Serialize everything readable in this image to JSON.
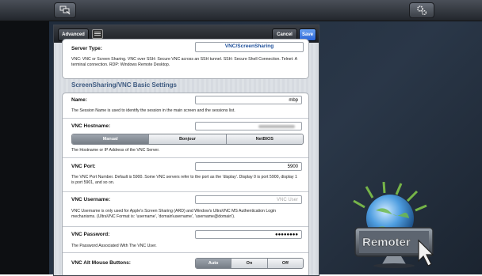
{
  "topbar": {
    "left_icon": "remote-screens-icon",
    "right_icon": "gear-icon"
  },
  "panel": {
    "header": {
      "advanced_label": "Advanced",
      "keyboard_icon": "keyboard-icon",
      "cancel_label": "Cancel",
      "save_label": "Save"
    },
    "server_type": {
      "label": "Server Type:",
      "value": "VNC/ScreenSharing",
      "description": "VNC: VNC or Screen Sharing. VNC over SSH: Secure VNC across an SSH tunnel. SSH: Secure Shell Connection. Telnet: A terminal connection. RDP: Windows Remote Desktop."
    },
    "section_title": "ScreenSharing/VNC Basic Settings",
    "name": {
      "label": "Name:",
      "value": "mbp",
      "description": "The Session Name is used to identify the session in the main screen and the sessions list."
    },
    "hostname": {
      "label": "VNC Hostname:",
      "value": "",
      "segments": [
        "Manual",
        "Bonjour",
        "NetBIOS"
      ],
      "selected": "Manual",
      "description": "The Hostname or IP Address of the VNC Server."
    },
    "port": {
      "label": "VNC Port:",
      "value": "5900",
      "description": "The VNC Port Number. Default is 5900. Some VNC servers refer to the port as the 'display'. Display 0 is port 5900, display 1 is port 5901, and so on."
    },
    "username": {
      "label": "VNC Username:",
      "placeholder": "VNC User",
      "description": "VNC Username is only used for Apple's Screen Sharing (ARD) and Window's UltraVNC MS Authentication Login mechanisms. (UltraVNC Format is: 'username', 'domain\\username', 'username@domain')."
    },
    "password": {
      "label": "VNC Password:",
      "value": "●●●●●●●●",
      "description": "The Password Associated With The VNC User."
    },
    "alt_mouse": {
      "label": "VNC Alt Mouse Buttons:",
      "segments": [
        "Auto",
        "On",
        "Off"
      ],
      "selected": "Auto"
    }
  },
  "logo": {
    "text": "Remoter",
    "icon": "globe-monitor-cursor-icon"
  },
  "colors": {
    "accent_blue": "#2a64d6",
    "section_title": "#3e5a80",
    "server_type_value": "#1d4f9a"
  }
}
